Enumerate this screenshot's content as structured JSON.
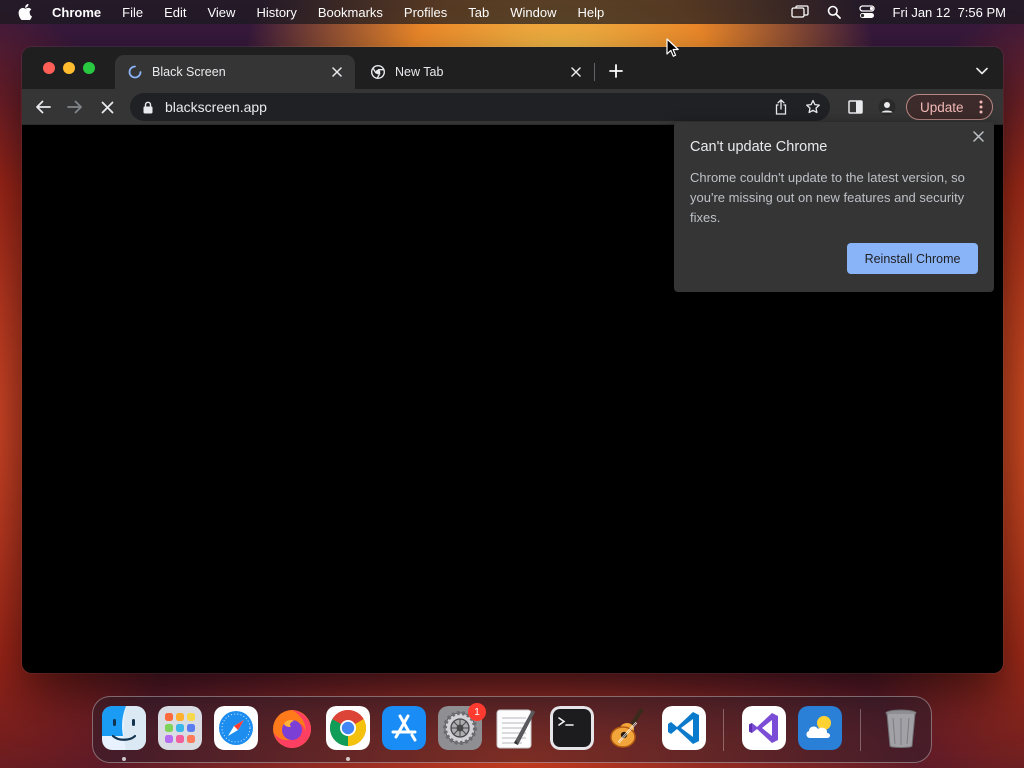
{
  "menubar": {
    "app_name": "Chrome",
    "items": [
      "File",
      "Edit",
      "View",
      "History",
      "Bookmarks",
      "Profiles",
      "Tab",
      "Window",
      "Help"
    ],
    "clock": "Fri Jan 12  7:56 PM"
  },
  "tabs": [
    {
      "title": "Black Screen",
      "state": "loading",
      "active": true
    },
    {
      "title": "New Tab",
      "state": "loaded",
      "active": false
    }
  ],
  "toolbar": {
    "url": "blackscreen.app",
    "update_label": "Update"
  },
  "bubble": {
    "title": "Can't update Chrome",
    "body": "Chrome couldn't update to the latest version, so you're missing out on new features and security fixes.",
    "button_label": "Reinstall Chrome"
  },
  "dock": {
    "apps": [
      "Finder",
      "Launchpad",
      "Safari",
      "Firefox",
      "Google Chrome",
      "App Store",
      "System Settings",
      "TextEdit",
      "Terminal",
      "GarageBand",
      "Visual Studio Code",
      "Visual Studio",
      "Weather",
      "Trash"
    ],
    "settings_badge": "1"
  },
  "colors": {
    "accent_blue": "#8ab4f8",
    "update_text": "#f2b8b5",
    "window_bg": "#000000",
    "toolbar_bg": "#353535"
  }
}
